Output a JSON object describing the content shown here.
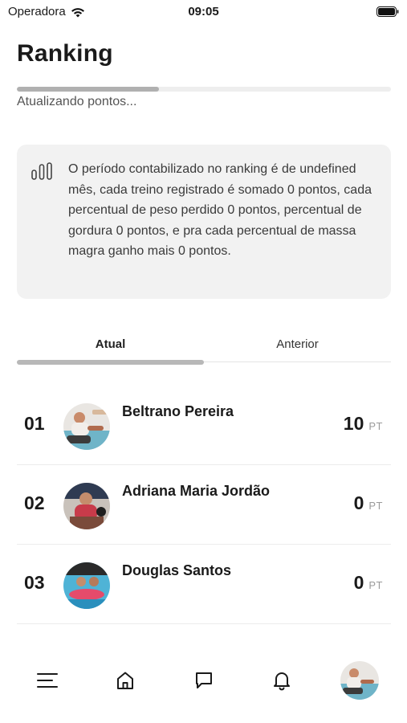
{
  "status_bar": {
    "carrier": "Operadora",
    "time": "09:05"
  },
  "header": {
    "title": "Ranking"
  },
  "progress": {
    "label": "Atualizando pontos...",
    "fraction": 0.38
  },
  "info_card": {
    "icon": "bar-chart-icon",
    "text": "O período contabilizado no ranking é de undefined mês, cada treino registrado é somado 0 pontos, cada percentual de peso perdido 0 pontos, percentual de gordura 0 pontos, e pra cada percentual de massa magra ganho mais 0 pontos."
  },
  "tabs": [
    {
      "label": "Atual",
      "active": true
    },
    {
      "label": "Anterior",
      "active": false
    }
  ],
  "ranking": [
    {
      "position": "01",
      "name": "Beltrano Pereira",
      "score": "10",
      "unit": "PT"
    },
    {
      "position": "02",
      "name": "Adriana Maria Jordão",
      "score": "0",
      "unit": "PT"
    },
    {
      "position": "03",
      "name": "Douglas Santos",
      "score": "0",
      "unit": "PT"
    }
  ],
  "bottom_nav": {
    "items": [
      "menu-icon",
      "home-icon",
      "chat-icon",
      "bell-icon",
      "profile-avatar"
    ]
  }
}
